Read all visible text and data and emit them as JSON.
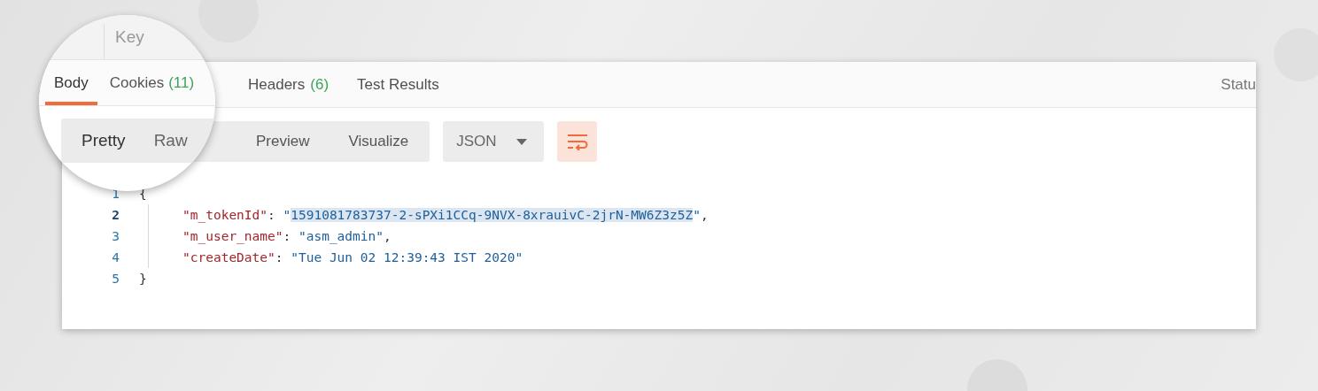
{
  "magnifier": {
    "column_header": "Key",
    "tabs": [
      {
        "label": "Body",
        "selected": true
      },
      {
        "label": "Cookies",
        "count": "(11)",
        "selected": false
      }
    ],
    "view_modes": [
      {
        "label": "Pretty",
        "selected": true
      },
      {
        "label": "Raw",
        "selected": false
      }
    ]
  },
  "response_tabs": [
    {
      "label": "Headers",
      "count": "(6)",
      "selected": false
    },
    {
      "label": "Test Results",
      "selected": false
    }
  ],
  "status_label": "Statu",
  "view_modes": [
    {
      "label": "Preview",
      "selected": false
    },
    {
      "label": "Visualize",
      "selected": false
    }
  ],
  "format_dropdown": {
    "value": "JSON"
  },
  "code_lines": [
    {
      "number": "1",
      "current": false,
      "indent": false,
      "parts": [
        {
          "kind": "punct",
          "text": "{",
          "highlighted": false
        }
      ]
    },
    {
      "number": "2",
      "current": true,
      "indent": true,
      "parts": [
        {
          "kind": "key",
          "text": "\"m_tokenId\"",
          "highlighted": false
        },
        {
          "kind": "punct",
          "text": ": ",
          "highlighted": false
        },
        {
          "kind": "string",
          "text": "\"",
          "highlighted": false
        },
        {
          "kind": "string",
          "text": "1591081783737-2-sPXi1CCq-9NVX-8xrauivC-2jrN-MW6Z3z5Z",
          "highlighted": true
        },
        {
          "kind": "string",
          "text": "\"",
          "highlighted": false
        },
        {
          "kind": "punct",
          "text": ",",
          "highlighted": false
        }
      ]
    },
    {
      "number": "3",
      "current": false,
      "indent": true,
      "parts": [
        {
          "kind": "key",
          "text": "\"m_user_name\"",
          "highlighted": false
        },
        {
          "kind": "punct",
          "text": ": ",
          "highlighted": false
        },
        {
          "kind": "string",
          "text": "\"asm_admin\"",
          "highlighted": false
        },
        {
          "kind": "punct",
          "text": ",",
          "highlighted": false
        }
      ]
    },
    {
      "number": "4",
      "current": false,
      "indent": true,
      "parts": [
        {
          "kind": "key",
          "text": "\"createDate\"",
          "highlighted": false
        },
        {
          "kind": "punct",
          "text": ": ",
          "highlighted": false
        },
        {
          "kind": "string",
          "text": "\"Tue Jun 02 12:39:43 IST 2020\"",
          "highlighted": false
        }
      ]
    },
    {
      "number": "5",
      "current": false,
      "indent": false,
      "parts": [
        {
          "kind": "punct",
          "text": "}",
          "highlighted": false
        }
      ]
    }
  ]
}
